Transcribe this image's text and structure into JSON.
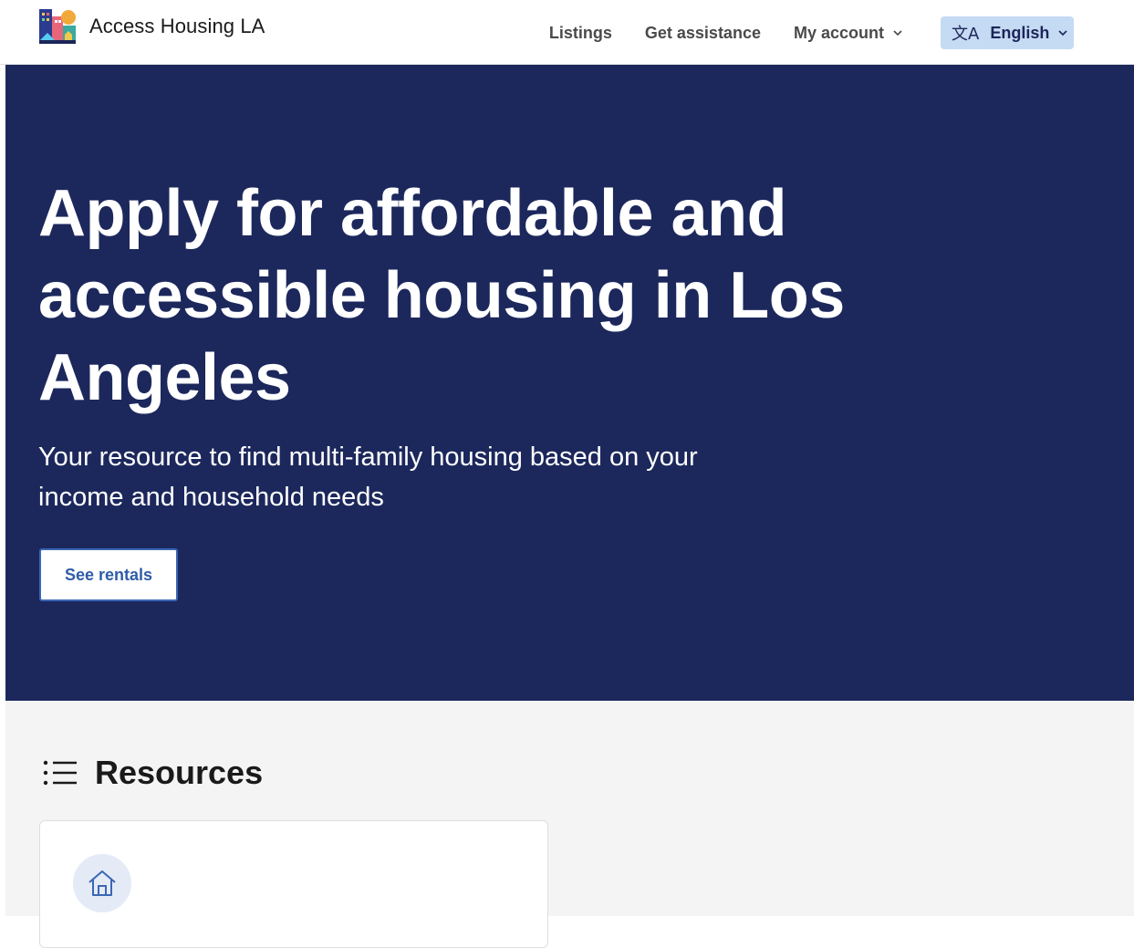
{
  "header": {
    "brand_name": "Access Housing LA",
    "logo_icon": "city-buildings-logo",
    "nav": {
      "listings": "Listings",
      "get_assistance": "Get assistance",
      "my_account": "My account"
    },
    "language": {
      "icon": "translate-icon",
      "label": "English"
    }
  },
  "hero": {
    "title": "Apply for affordable and accessible housing in Los Angeles",
    "subtitle": "Your resource to find multi-family housing based on your income and household needs",
    "cta_label": "See rentals",
    "background": "#1c285c"
  },
  "resources": {
    "title": "Resources",
    "icon": "list-icon",
    "card_icon": "home-icon"
  },
  "colors": {
    "accent": "#3a66b6",
    "lang_button_bg": "#c5daf3",
    "section_bg": "#f4f4f4"
  }
}
